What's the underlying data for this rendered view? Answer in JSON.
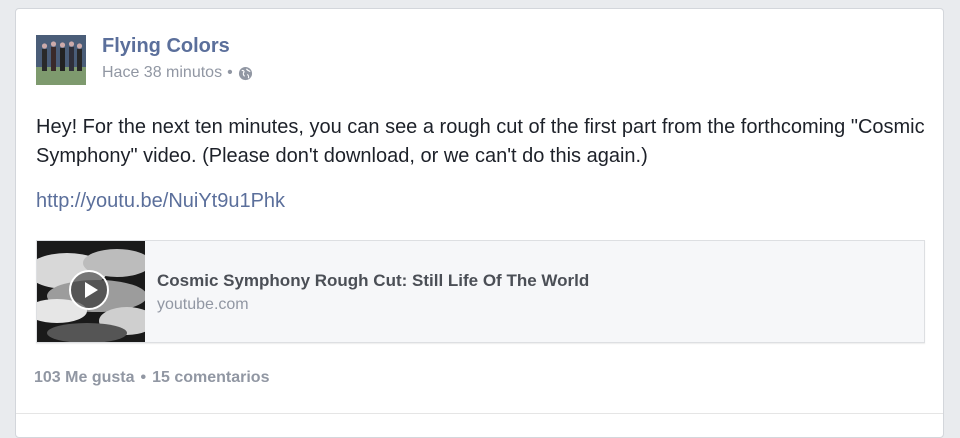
{
  "post": {
    "author": "Flying Colors",
    "timestamp": "Hace 38 minutos",
    "separator": "•",
    "privacy_icon": "globe-icon",
    "text": "Hey! For the next ten minutes, you can see a rough cut of the first part from the forthcoming \"Cosmic Symphony\" video. (Please don't download, or we can't do this again.)",
    "link": "http://youtu.be/NuiYt9u1Phk",
    "attachment": {
      "title": "Cosmic Symphony Rough Cut: Still Life Of The World",
      "domain": "youtube.com",
      "thumbnail_icon": "play-icon"
    },
    "stats": {
      "likes": "103 Me gusta",
      "separator": "•",
      "comments": "15 comentarios"
    }
  },
  "colors": {
    "link": "#5b6f9b",
    "muted": "#9197a3",
    "text": "#1d2129"
  }
}
